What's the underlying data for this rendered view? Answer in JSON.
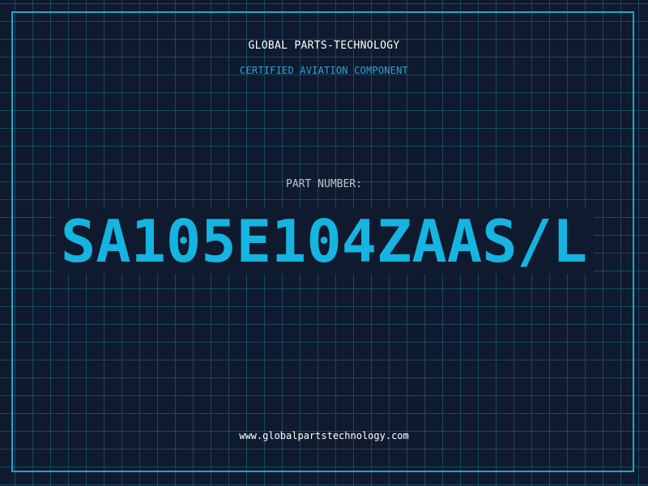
{
  "header": {
    "company": "GLOBAL PARTS-TECHNOLOGY",
    "subtitle": "CERTIFIED AVIATION COMPONENT"
  },
  "part": {
    "label": "PART NUMBER:",
    "number": "SA105E104ZAAS/L"
  },
  "footer": {
    "website": "www.globalpartstechnology.com"
  },
  "colors": {
    "background": "#0f1a2e",
    "grid": "#1e6e8c",
    "frame": "#1fa6c8",
    "accent": "#16b4e0",
    "subtitle": "#29a7d6",
    "label": "#b8c4d0",
    "text": "#ffffff"
  }
}
